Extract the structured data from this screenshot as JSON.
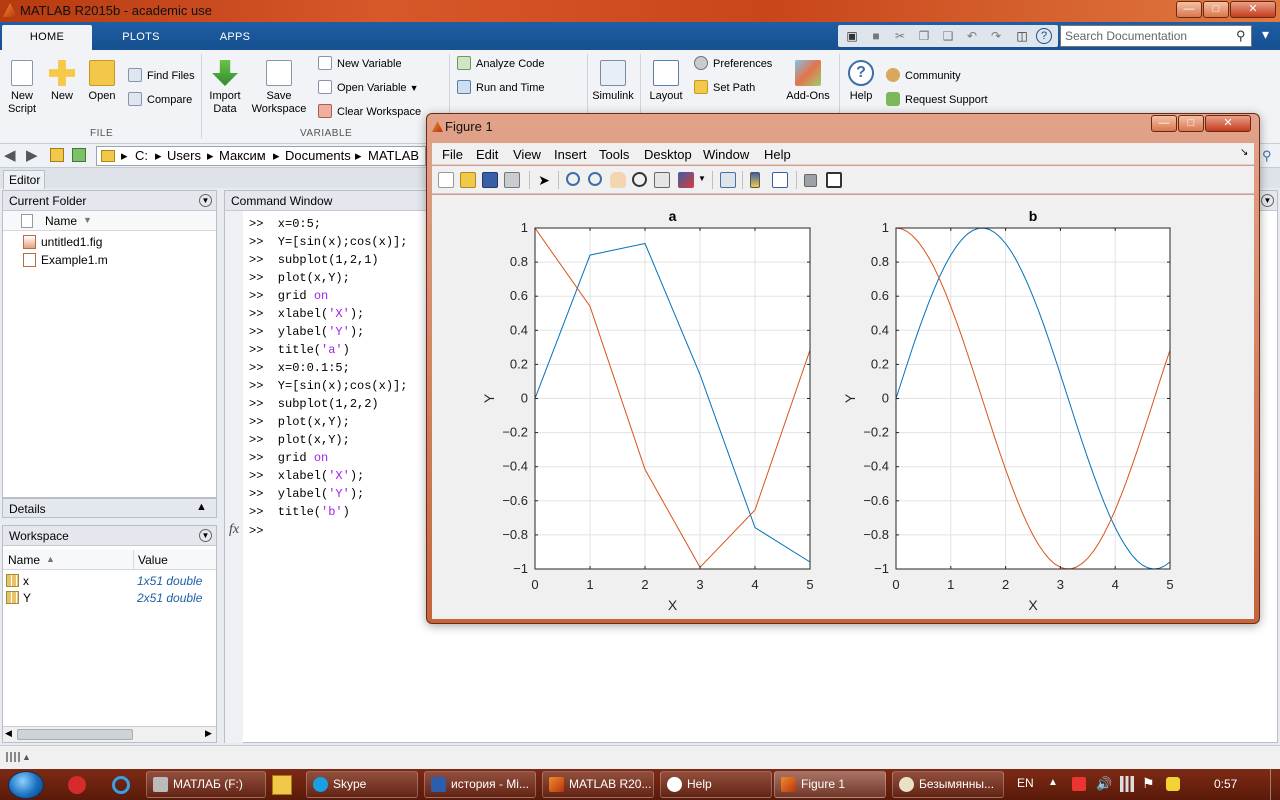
{
  "window": {
    "title": "MATLAB R2015b - academic use"
  },
  "ribbon_tabs": [
    "HOME",
    "PLOTS",
    "APPS"
  ],
  "search": {
    "placeholder": "Search Documentation"
  },
  "ribbon": {
    "file": {
      "label": "FILE",
      "new_script": "New Script",
      "new": "New",
      "open": "Open",
      "find_files": "Find Files",
      "compare": "Compare"
    },
    "variable": {
      "label": "VARIABLE",
      "import_data": "Import Data",
      "save_workspace": "Save Workspace",
      "new_variable": "New Variable",
      "open_variable": "Open Variable",
      "clear_workspace": "Clear Workspace"
    },
    "code": {
      "analyze_code": "Analyze Code",
      "run_and_time": "Run and Time"
    },
    "simulink": "Simulink",
    "layout": "Layout",
    "preferences": "Preferences",
    "set_path": "Set Path",
    "add_ons": "Add-Ons",
    "help": "Help",
    "community": "Community",
    "request_support": "Request Support"
  },
  "address": {
    "crumbs": [
      "C:",
      "Users",
      "Максим",
      "Documents",
      "MATLAB"
    ]
  },
  "editor_tab": "Editor",
  "current_folder": {
    "title": "Current Folder",
    "column": "Name",
    "files": [
      "untitled1.fig",
      "Example1.m"
    ]
  },
  "details": {
    "title": "Details"
  },
  "workspace": {
    "title": "Workspace",
    "columns": [
      "Name",
      "Value"
    ],
    "rows": [
      {
        "name": "x",
        "value": "1x51 double"
      },
      {
        "name": "Y",
        "value": "2x51 double"
      }
    ]
  },
  "command_window": {
    "title": "Command Window",
    "prompt": ">>",
    "fx": "fx",
    "lines": [
      {
        "code": "x=0:5;"
      },
      {
        "code": "Y=[sin(x);cos(x)];"
      },
      {
        "code": "subplot(1,2,1)"
      },
      {
        "code": "plot(x,Y);"
      },
      {
        "code": "grid ",
        "kw": "on"
      },
      {
        "code": "xlabel(",
        "kw": "'X'",
        "tail": ");"
      },
      {
        "code": "ylabel(",
        "kw": "'Y'",
        "tail": ");"
      },
      {
        "code": "title(",
        "kw": "'a'",
        "tail": ")"
      },
      {
        "code": "x=0:0.1:5;"
      },
      {
        "code": "Y=[sin(x);cos(x)];"
      },
      {
        "code": "subplot(1,2,2)"
      },
      {
        "code": "plot(x,Y);"
      },
      {
        "code": "plot(x,Y);"
      },
      {
        "code": "grid ",
        "kw": "on"
      },
      {
        "code": "xlabel(",
        "kw": "'X'",
        "tail": ");"
      },
      {
        "code": "ylabel(",
        "kw": "'Y'",
        "tail": ");"
      },
      {
        "code": "title(",
        "kw": "'b'",
        "tail": ")"
      }
    ]
  },
  "figure": {
    "title": "Figure 1",
    "menus": [
      "File",
      "Edit",
      "View",
      "Insert",
      "Tools",
      "Desktop",
      "Window",
      "Help"
    ]
  },
  "chart_data": [
    {
      "type": "line",
      "title": "a",
      "xlabel": "X",
      "ylabel": "Y",
      "xlim": [
        0,
        5
      ],
      "ylim": [
        -1,
        1
      ],
      "xticks": [
        "0",
        "1",
        "2",
        "3",
        "4",
        "5"
      ],
      "yticks": [
        "-1",
        "-0.8",
        "-0.6",
        "-0.4",
        "-0.2",
        "0",
        "0.2",
        "0.4",
        "0.6",
        "0.8",
        "1"
      ],
      "grid": true,
      "x": [
        0,
        1,
        2,
        3,
        4,
        5
      ],
      "series": [
        {
          "color": "#0072BD",
          "values": [
            0,
            0.841,
            0.909,
            0.141,
            -0.757,
            -0.959
          ]
        },
        {
          "color": "#D95319",
          "values": [
            1,
            0.54,
            -0.416,
            -0.99,
            -0.654,
            0.284
          ]
        }
      ]
    },
    {
      "type": "line",
      "title": "b",
      "xlabel": "X",
      "ylabel": "Y",
      "xlim": [
        0,
        5
      ],
      "ylim": [
        -1,
        1
      ],
      "xticks": [
        "0",
        "1",
        "2",
        "3",
        "4",
        "5"
      ],
      "yticks": [
        "-1",
        "-0.8",
        "-0.6",
        "-0.4",
        "-0.2",
        "0",
        "0.2",
        "0.4",
        "0.6",
        "0.8",
        "1"
      ],
      "grid": true,
      "x": [
        0,
        0.1,
        0.2,
        0.3,
        0.4,
        0.5,
        0.6,
        0.7,
        0.8,
        0.9,
        1,
        1.1,
        1.2,
        1.3,
        1.4,
        1.5,
        1.6,
        1.7,
        1.8,
        1.9,
        2,
        2.1,
        2.2,
        2.3,
        2.4,
        2.5,
        2.6,
        2.7,
        2.8,
        2.9,
        3,
        3.1,
        3.2,
        3.3,
        3.4,
        3.5,
        3.6,
        3.7,
        3.8,
        3.9,
        4,
        4.1,
        4.2,
        4.3,
        4.4,
        4.5,
        4.6,
        4.7,
        4.8,
        4.9,
        5
      ],
      "series": [
        {
          "color": "#0072BD",
          "values": [
            0,
            0.0998,
            0.1987,
            0.2955,
            0.3894,
            0.4794,
            0.5646,
            0.6442,
            0.7174,
            0.7833,
            0.8415,
            0.8912,
            0.932,
            0.9636,
            0.9854,
            0.9975,
            0.9996,
            0.9917,
            0.9738,
            0.9463,
            0.9093,
            0.8632,
            0.8085,
            0.7457,
            0.6755,
            0.5985,
            0.5155,
            0.4274,
            0.335,
            0.2392,
            0.1411,
            0.0416,
            -0.0584,
            -0.1577,
            -0.2555,
            -0.3508,
            -0.4425,
            -0.5298,
            -0.6119,
            -0.6878,
            -0.7568,
            -0.8183,
            -0.8716,
            -0.9162,
            -0.9516,
            -0.9775,
            -0.9937,
            -0.9999,
            -0.9962,
            -0.9825,
            -0.9589
          ]
        },
        {
          "color": "#D95319",
          "values": [
            1,
            0.995,
            0.9801,
            0.9553,
            0.9211,
            0.8776,
            0.8253,
            0.7648,
            0.6967,
            0.6216,
            0.5403,
            0.4536,
            0.3624,
            0.2675,
            0.17,
            0.0707,
            -0.0292,
            -0.1288,
            -0.2272,
            -0.3233,
            -0.4161,
            -0.5048,
            -0.5885,
            -0.6663,
            -0.7374,
            -0.8011,
            -0.8569,
            -0.9041,
            -0.9422,
            -0.971,
            -0.99,
            -0.9991,
            -0.9983,
            -0.9875,
            -0.9668,
            -0.9365,
            -0.8968,
            -0.8481,
            -0.791,
            -0.7259,
            -0.6536,
            -0.5748,
            -0.4903,
            -0.4008,
            -0.3073,
            -0.2108,
            -0.1122,
            -0.0124,
            0.0875,
            0.1865,
            0.2837
          ]
        }
      ]
    }
  ],
  "taskbar": {
    "items": [
      "МАТЛАБ (F:)",
      "Skype",
      "история - Mi...",
      "MATLAB R20...",
      "Help",
      "Figure 1",
      "Безымянны..."
    ],
    "lang": "EN",
    "clock": "0:57"
  }
}
